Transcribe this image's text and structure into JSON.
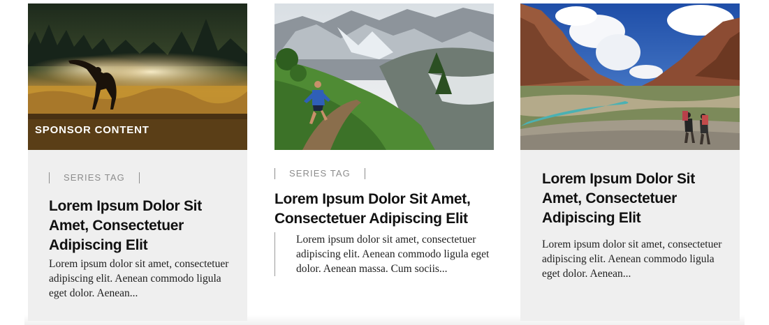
{
  "cards": [
    {
      "image_alt": "Silhouette of a woman stretching in a misty golden field at sunrise",
      "label": "SPONSOR CONTENT",
      "tag": "SERIES TAG",
      "title": "Lorem Ipsum Dolor Sit Amet, Consectetuer Adipiscing Elit",
      "excerpt": "Lorem ipsum dolor sit amet, consectetuer adipiscing elit. Aenean commodo ligula eget dolor. Aenean..."
    },
    {
      "image_alt": "Trail runner on a green mountain path with snowy peaks behind",
      "tag": "SERIES TAG",
      "title": "Lorem Ipsum Dolor Sit Amet, Consectetuer Adipiscing Elit",
      "excerpt": "Lorem ipsum dolor sit amet, consectetuer adipiscing elit. Aenean commodo ligula eget dolor. Aenean massa. Cum sociis..."
    },
    {
      "image_alt": "Two hikers walking along a rocky river valley between red cliffs",
      "title": "Lorem Ipsum Dolor Sit Amet, Consectetuer Adipiscing Elit",
      "excerpt": "Lorem ipsum dolor sit amet, consectetuer adipiscing elit. Aenean commodo ligula eget dolor. Aenean..."
    }
  ]
}
